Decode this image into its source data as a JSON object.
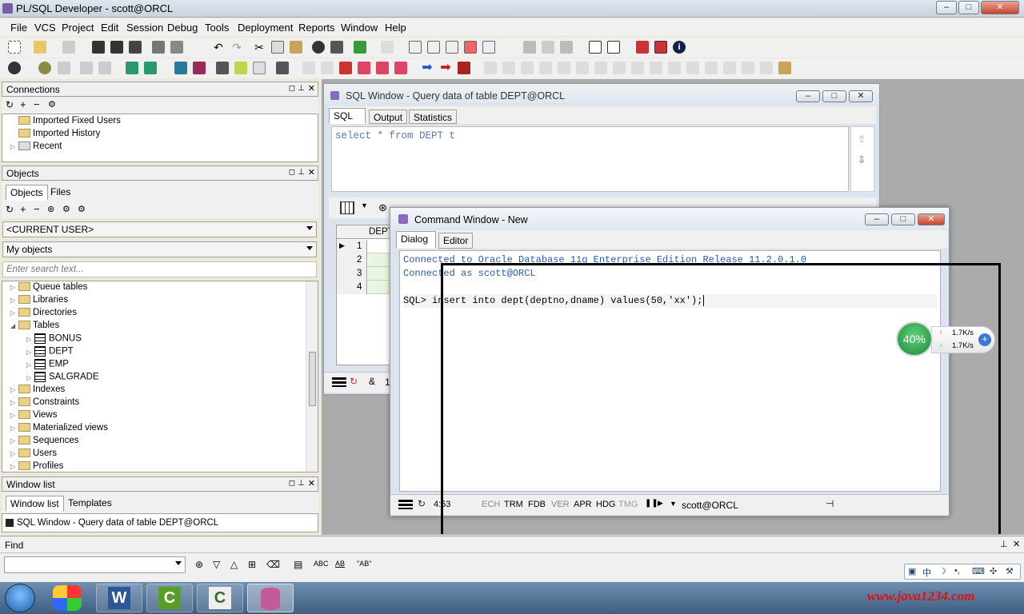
{
  "app": {
    "title": "PL/SQL Developer - scott@ORCL"
  },
  "menu": [
    "File",
    "VCS",
    "Project",
    "Edit",
    "Session",
    "Debug",
    "Tools",
    "Deployment",
    "Reports",
    "Window",
    "Help"
  ],
  "connections": {
    "title": "Connections",
    "items": [
      "Imported Fixed Users",
      "Imported History",
      "Recent"
    ]
  },
  "objects": {
    "title": "Objects",
    "tabs": [
      "Objects",
      "Files"
    ],
    "user_select": "<CURRENT USER>",
    "filter_select": "My objects",
    "search_placeholder": "Enter search text...",
    "tree": [
      {
        "label": "Queue tables",
        "type": "folder"
      },
      {
        "label": "Libraries",
        "type": "folder"
      },
      {
        "label": "Directories",
        "type": "folder"
      },
      {
        "label": "Tables",
        "type": "folder"
      },
      {
        "label": "BONUS",
        "type": "table"
      },
      {
        "label": "DEPT",
        "type": "table"
      },
      {
        "label": "EMP",
        "type": "table"
      },
      {
        "label": "SALGRADE",
        "type": "table"
      },
      {
        "label": "Indexes",
        "type": "folder"
      },
      {
        "label": "Constraints",
        "type": "folder"
      },
      {
        "label": "Views",
        "type": "folder"
      },
      {
        "label": "Materialized views",
        "type": "folder"
      },
      {
        "label": "Sequences",
        "type": "folder"
      },
      {
        "label": "Users",
        "type": "folder"
      },
      {
        "label": "Profiles",
        "type": "folder"
      }
    ]
  },
  "window_list": {
    "title": "Window list",
    "tabs": [
      "Window list",
      "Templates"
    ],
    "items": [
      "SQL Window - Query data of table DEPT@ORCL"
    ]
  },
  "sql_window": {
    "title": "SQL Window - Query data of table DEPT@ORCL",
    "tabs": [
      "SQL",
      "Output",
      "Statistics"
    ],
    "query": "select * from DEPT t",
    "grid_header": "DEPT",
    "rows": [
      "1",
      "2",
      "3",
      "4"
    ],
    "status_num": "1"
  },
  "command_window": {
    "title": "Command Window - New",
    "tabs": [
      "Dialog",
      "Editor"
    ],
    "lines": [
      "Connected to Oracle Database 11g Enterprise Edition Release 11.2.0.1.0",
      "Connected as scott@ORCL",
      "",
      "SQL> insert into dept(deptno,dname) values(50,'xx');"
    ],
    "status": {
      "pos": "4:53",
      "flags": [
        "ECH",
        "TRM",
        "FDB",
        "VER",
        "APR",
        "HDG",
        "TMG"
      ],
      "conn": "scott@ORCL"
    }
  },
  "net_widget": {
    "percent": "40%",
    "up": "1.7K/s",
    "down": "1.7K/s"
  },
  "find": {
    "title": "Find",
    "labels": [
      "ABC",
      "AB",
      "\"AB\""
    ]
  },
  "taskbar": {
    "watermark": "www.java1234.com",
    "ime": "中"
  }
}
